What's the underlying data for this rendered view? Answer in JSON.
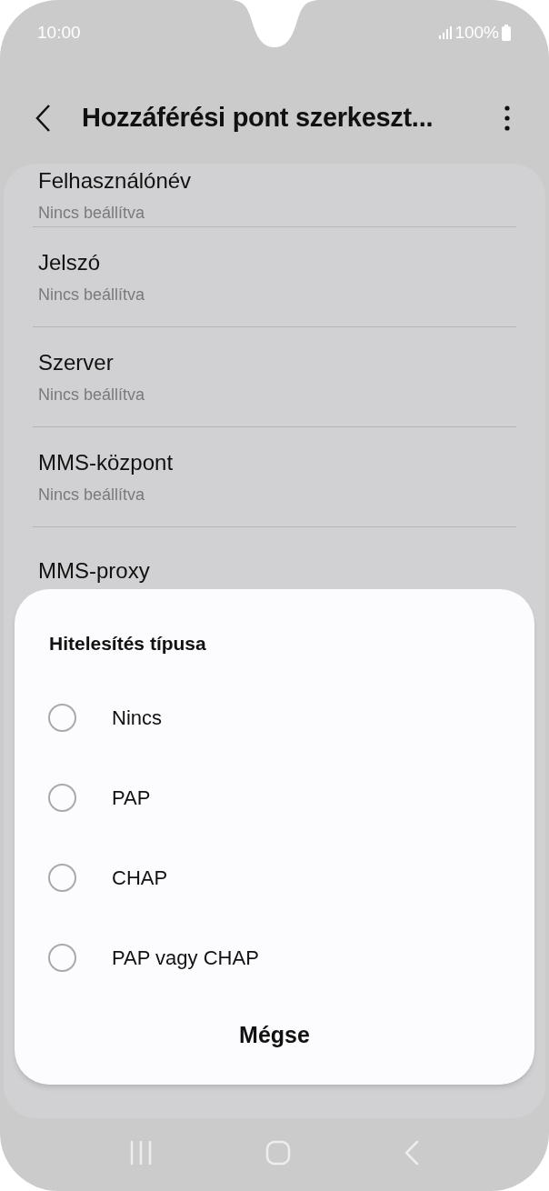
{
  "status_bar": {
    "time": "10:00",
    "battery": "100%"
  },
  "header": {
    "title": "Hozzáférési pont szerkeszt..."
  },
  "settings": [
    {
      "title": "Felhasználónév",
      "value": "Nincs beállítva"
    },
    {
      "title": "Jelszó",
      "value": "Nincs beállítva"
    },
    {
      "title": "Szerver",
      "value": "Nincs beállítva"
    },
    {
      "title": "MMS-központ",
      "value": "Nincs beállítva"
    },
    {
      "title": "MMS-proxy"
    }
  ],
  "dialog": {
    "title": "Hitelesítés típusa",
    "options": [
      {
        "label": "Nincs",
        "selected": false
      },
      {
        "label": "PAP",
        "selected": false
      },
      {
        "label": "CHAP",
        "selected": false
      },
      {
        "label": "PAP vagy CHAP",
        "selected": false
      }
    ],
    "cancel": "Mégse"
  }
}
